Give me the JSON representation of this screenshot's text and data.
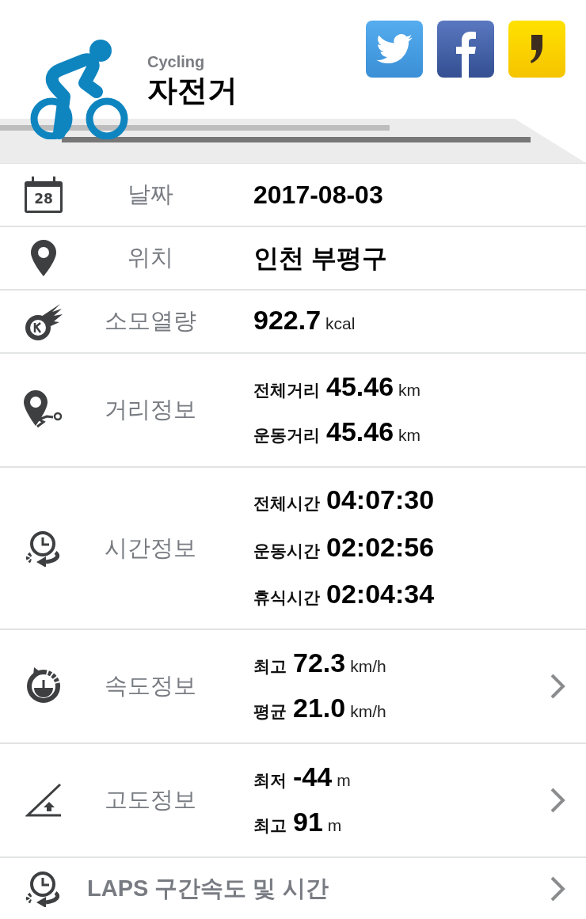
{
  "header": {
    "subtitle": "Cycling",
    "title": "자전거",
    "share": [
      {
        "kind": "twitter"
      },
      {
        "kind": "facebook"
      },
      {
        "kind": "kakaostory"
      }
    ]
  },
  "rows": [
    {
      "kind": "text",
      "icon_text": "28",
      "label": "날짜",
      "value": "2017-08-03",
      "has_detail": false
    },
    {
      "kind": "text",
      "label": "위치",
      "value": "인천 부평구",
      "has_detail": false
    },
    {
      "kind": "stats",
      "label": "소모열량",
      "stats": [
        {
          "value": "922.7",
          "unit": "kcal"
        }
      ],
      "has_detail": false
    },
    {
      "kind": "stats",
      "label": "거리정보",
      "stats": [
        {
          "label": "전체거리",
          "value": "45.46",
          "unit": "km"
        },
        {
          "label": "운동거리",
          "value": "45.46",
          "unit": "km"
        }
      ],
      "has_detail": false
    },
    {
      "kind": "stats",
      "label": "시간정보",
      "stats": [
        {
          "label": "전체시간",
          "value": "04:07:30"
        },
        {
          "label": "운동시간",
          "value": "02:02:56"
        },
        {
          "label": "휴식시간",
          "value": "02:04:34"
        }
      ],
      "has_detail": false
    },
    {
      "kind": "stats",
      "label": "속도정보",
      "stats": [
        {
          "label": "최고",
          "value": "72.3",
          "unit": "km/h"
        },
        {
          "label": "평균",
          "value": "21.0",
          "unit": "km/h"
        }
      ],
      "has_detail": true
    },
    {
      "kind": "stats",
      "label": "고도정보",
      "stats": [
        {
          "label": "최저",
          "value": "-44",
          "unit": "m"
        },
        {
          "label": "최고",
          "value": "91",
          "unit": "m"
        }
      ],
      "has_detail": true
    },
    {
      "kind": "link",
      "label": "LAPS 구간속도 및 시간",
      "has_detail": true
    }
  ]
}
